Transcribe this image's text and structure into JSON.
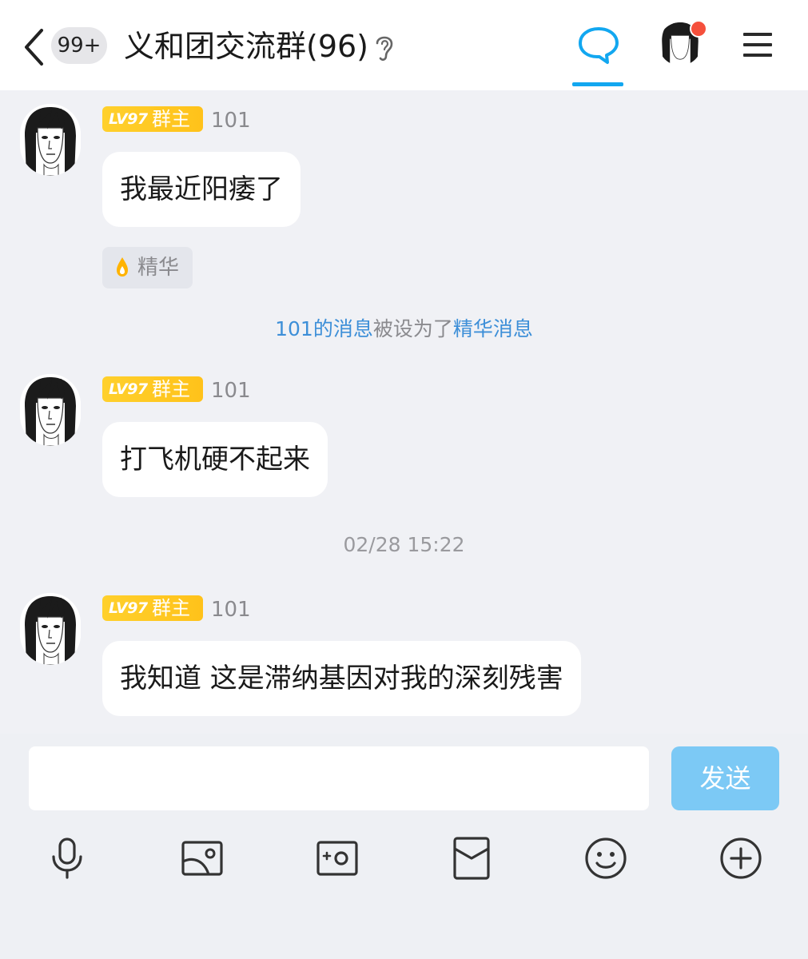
{
  "header": {
    "unread_count": "99+",
    "group_title": "义和团交流群(96)"
  },
  "messages": [
    {
      "level": "LV97",
      "role": "群主",
      "sender": "101",
      "text": "我最近阳痿了"
    },
    {
      "level": "LV97",
      "role": "群主",
      "sender": "101",
      "text": "打飞机硬不起来"
    },
    {
      "level": "LV97",
      "role": "群主",
      "sender": "101",
      "text": "我知道 这是滞纳基因对我的深刻残害"
    }
  ],
  "essence_tag": "精华",
  "system_notice": {
    "part1": "101的消息",
    "part2": "被设为了",
    "part3": "精华消息"
  },
  "timestamp": "02/28 15:22",
  "input": {
    "value": "",
    "send_label": "发送"
  },
  "toolbar": {
    "icons": [
      "microphone-icon",
      "picture-icon",
      "camera-icon",
      "red-envelope-icon",
      "emoji-icon",
      "plus-icon"
    ]
  },
  "colors": {
    "accent": "#12a7f0",
    "badge": "#ffc21a",
    "send_button": "#7cc9f5",
    "link": "#3d8fd8",
    "notification_dot": "#f5503c"
  }
}
